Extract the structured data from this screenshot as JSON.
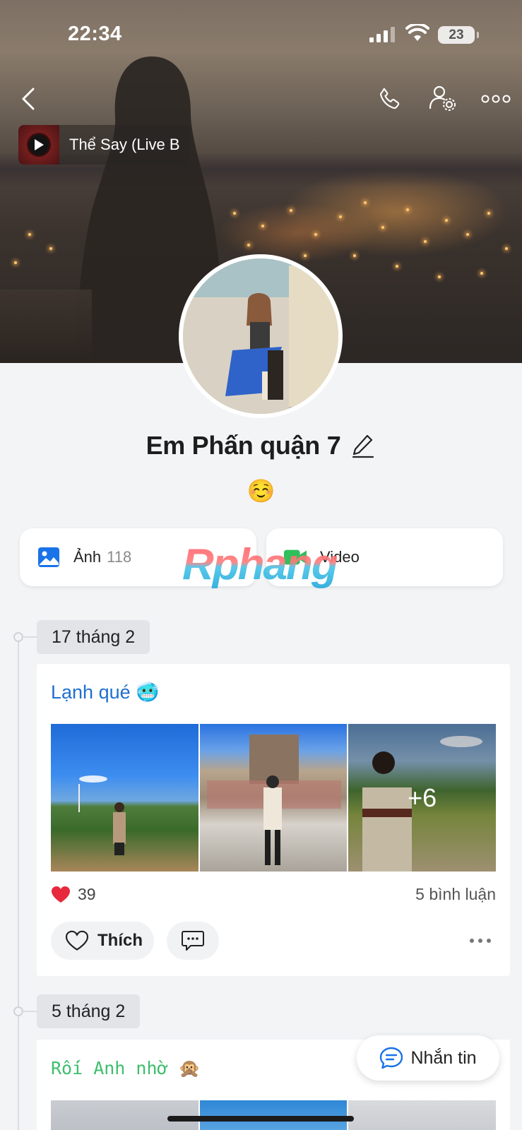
{
  "status_bar": {
    "time": "22:34",
    "battery": "23"
  },
  "music": {
    "title": "Thể Say (Live B"
  },
  "profile": {
    "name": "Em Phấn quận 7",
    "status_emoji": "☺️"
  },
  "media": {
    "photos_label": "Ảnh",
    "photos_count": "118",
    "video_label": "Video"
  },
  "watermark": "Rphang",
  "timeline": [
    {
      "date": "17 tháng 2",
      "caption": "Lạnh qué 🥶",
      "more_photos": "+6",
      "likes": "39",
      "comments": "5 bình luận",
      "like_label": "Thích"
    },
    {
      "date": "5 tháng 2",
      "caption": "Rối Anh nhờ 🙊"
    }
  ],
  "message_button": "Nhắn tin",
  "colors": {
    "accent_blue": "#1f6fd1",
    "green_caption": "#3fbe6e",
    "heart": "#e8283c"
  }
}
